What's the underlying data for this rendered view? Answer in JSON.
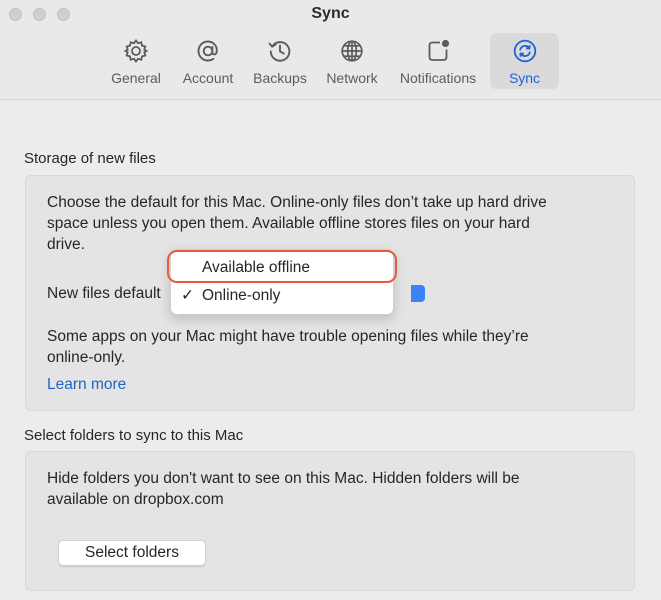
{
  "window": {
    "title": "Sync"
  },
  "toolbar": {
    "items": [
      {
        "label": "General",
        "icon": "gear-icon"
      },
      {
        "label": "Account",
        "icon": "at-sign-icon"
      },
      {
        "label": "Backups",
        "icon": "clock-history-icon"
      },
      {
        "label": "Network",
        "icon": "globe-icon"
      },
      {
        "label": "Notifications",
        "icon": "notification-badge-icon"
      },
      {
        "label": "Sync",
        "icon": "sync-icon",
        "active": true
      }
    ]
  },
  "storage": {
    "section_title": "Storage of new files",
    "description_line1": "Choose the default for this Mac. Online-only files don’t take up hard drive",
    "description_line2": "space unless you open them. Available offline stores files on your hard",
    "description_line3": "drive.",
    "new_files_label": "New files default",
    "warning_line1": "Some apps on your Mac might have trouble opening files while they’re",
    "warning_line2": "online-only.",
    "learn_more": "Learn more"
  },
  "dropdown_menu": {
    "options": [
      {
        "label": "Available offline",
        "checked": false
      },
      {
        "label": "Online-only",
        "checked": true
      }
    ],
    "check_glyph": "✓"
  },
  "folders": {
    "section_title": "Select folders to sync to this Mac",
    "description_line1": "Hide folders you don't want to see on this Mac. Hidden folders will be",
    "description_line2": "available on dropbox.com",
    "select_button": "Select folders"
  },
  "colors": {
    "accent": "#1f63d4",
    "link": "#1f66c4",
    "highlight": "#e85a3c"
  }
}
